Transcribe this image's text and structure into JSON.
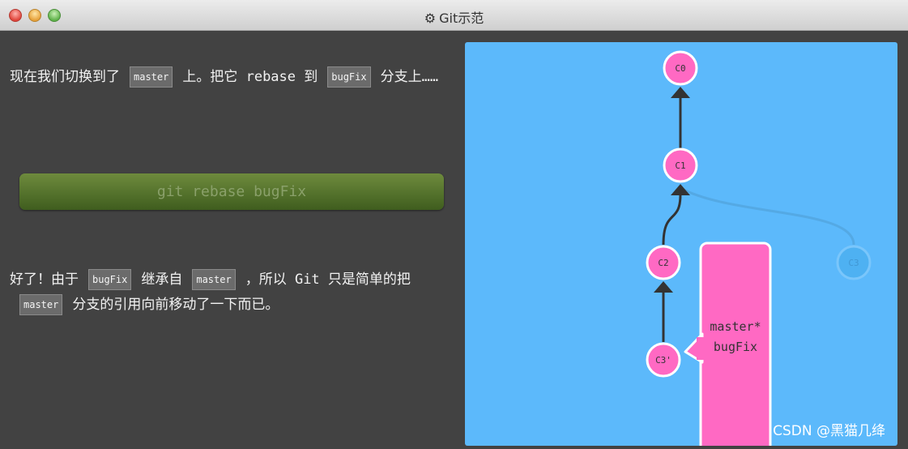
{
  "window": {
    "title": "Git示范",
    "gear_icon": "⚙"
  },
  "left": {
    "para1": {
      "t1": "现在我们切换到了",
      "code1": "master",
      "t2": "上。把它 rebase 到",
      "code2": "bugFix",
      "t3": "分支上……"
    },
    "command_label": "git rebase bugFix",
    "para2": {
      "t1": "好了！由于",
      "code1": "bugFix",
      "t2": "继承自",
      "code2": "master",
      "t3": "，所以 Git 只是简单的把",
      "code3": "master",
      "t4": "分支的引用向前移动了一下而已。"
    }
  },
  "graph": {
    "commits": [
      {
        "id": "C0",
        "label": "C0"
      },
      {
        "id": "C1",
        "label": "C1"
      },
      {
        "id": "C2",
        "label": "C2"
      },
      {
        "id": "C3'",
        "label": "C3'"
      },
      {
        "id": "C3",
        "label": "C3",
        "faded": true
      }
    ],
    "branch_labels": [
      "master*",
      "bugFix"
    ]
  },
  "colors": {
    "background": "#424242",
    "panel": "#5cb9fb",
    "commit": "#ff69c3",
    "command_button": "#55752d"
  },
  "watermark": "CSDN @黑猫几绛"
}
